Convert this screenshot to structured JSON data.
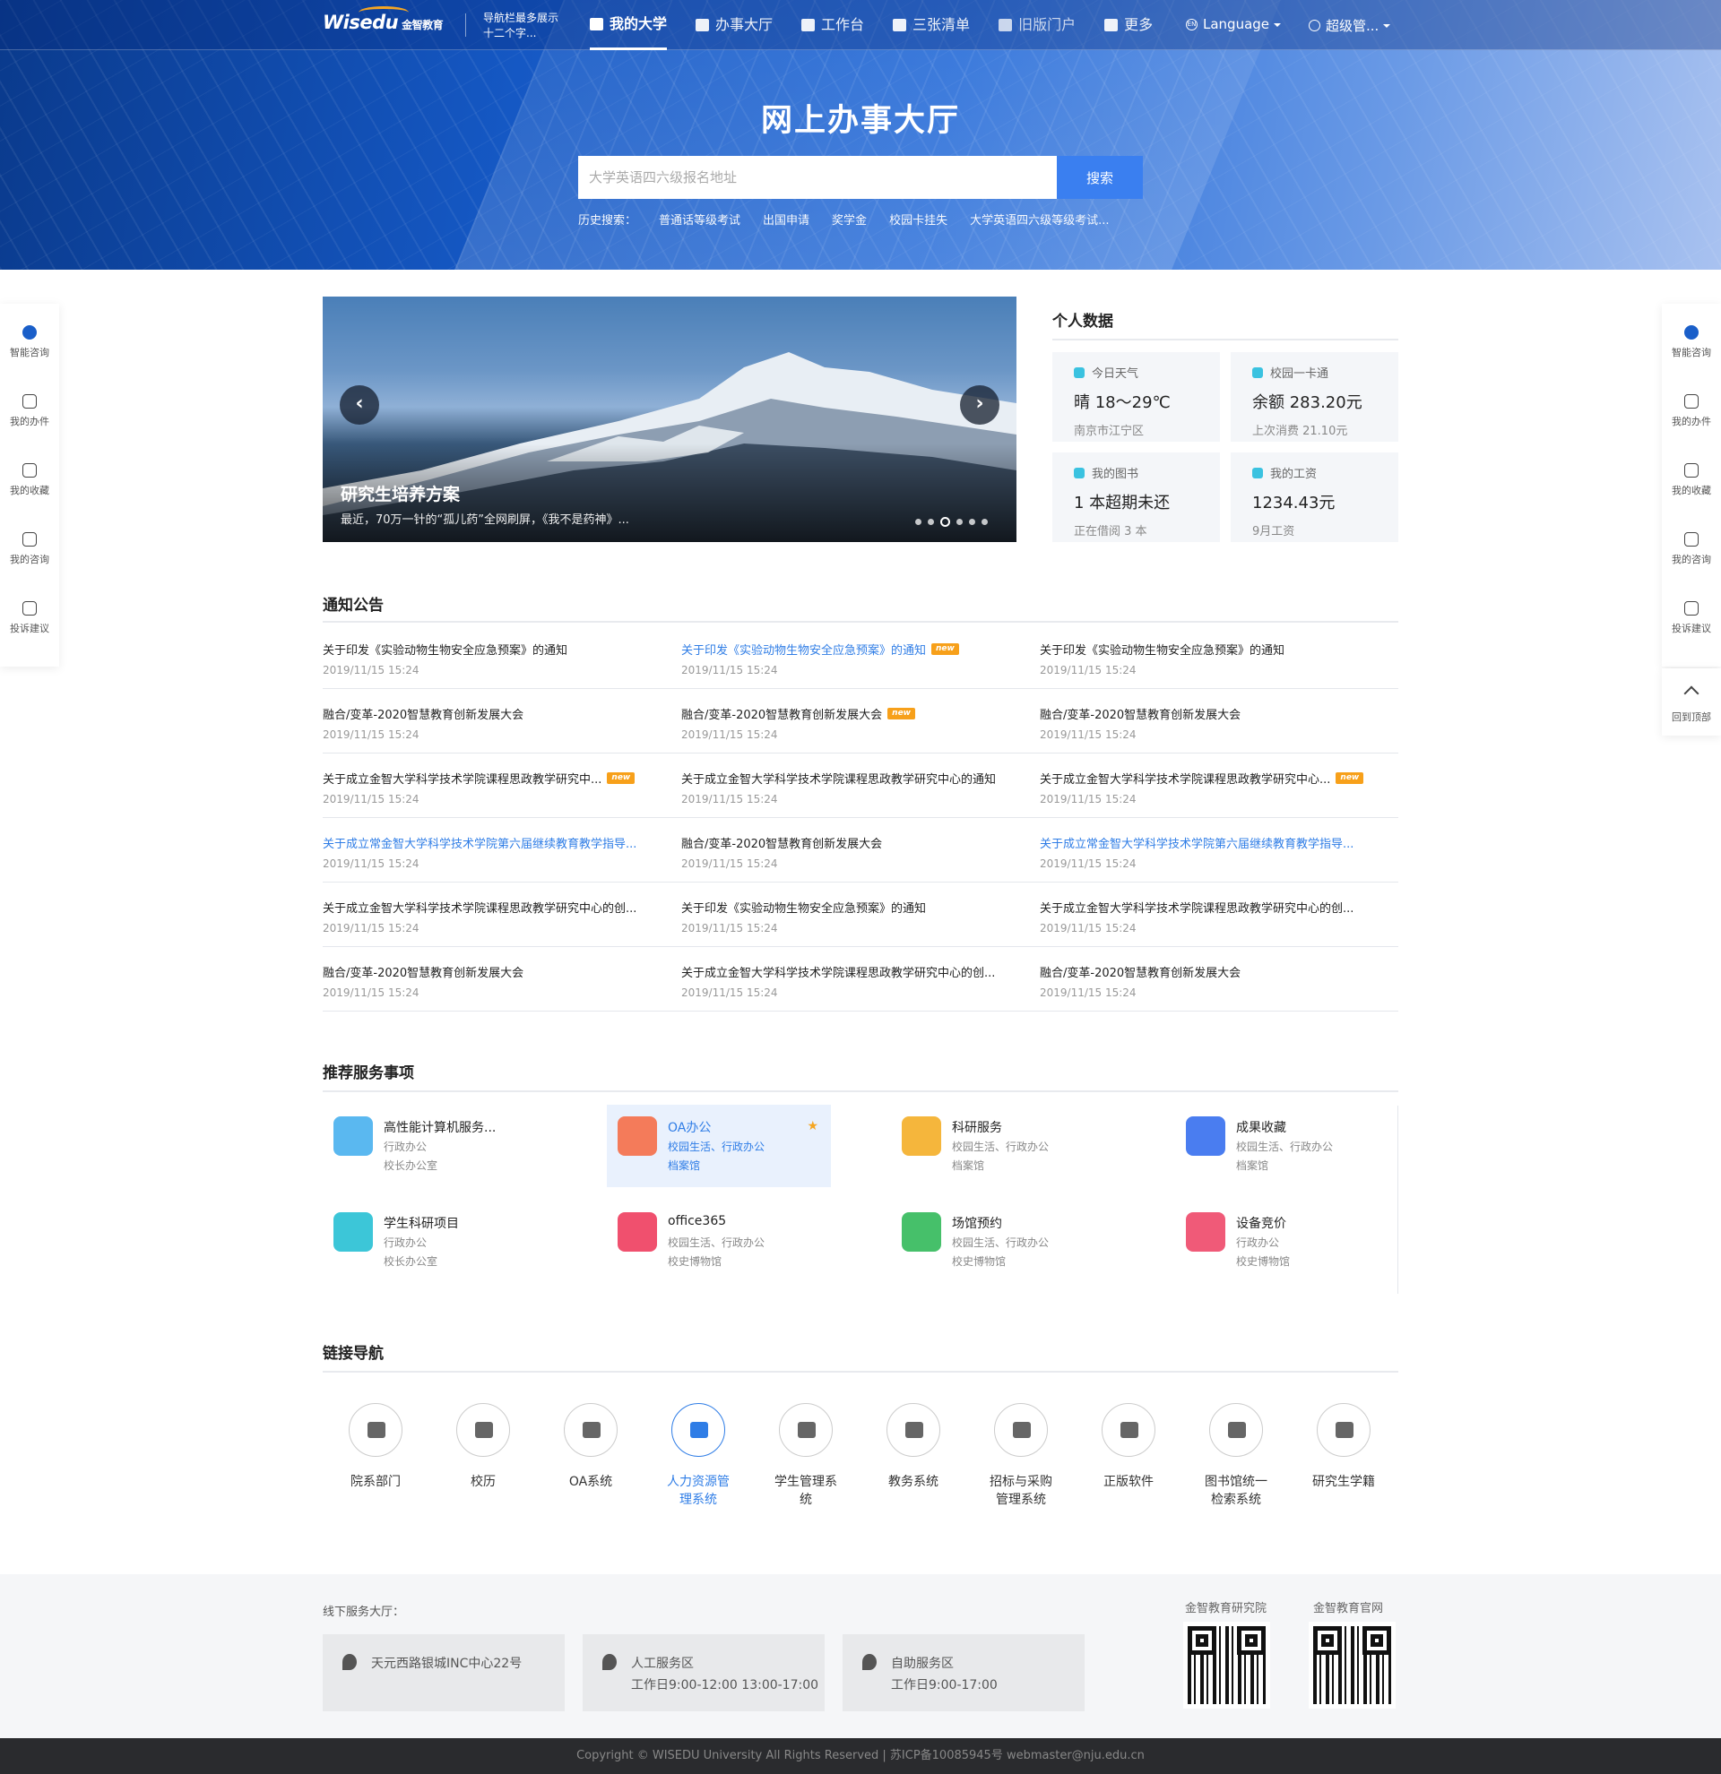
{
  "nav": {
    "logo": "Wisedu",
    "logo_cn": "金智教育",
    "note": "导航栏最多展示十二个字...",
    "menu": [
      {
        "label": "我的大学",
        "icon": "university-icon",
        "active": true
      },
      {
        "label": "办事大厅",
        "icon": "service-hall-icon",
        "active": false
      },
      {
        "label": "工作台",
        "icon": "workbench-icon",
        "active": false
      },
      {
        "label": "三张清单",
        "icon": "list-icon",
        "active": false
      },
      {
        "label": "旧版门户",
        "icon": "home-icon",
        "active": false
      },
      {
        "label": "更多",
        "icon": "grid-icon",
        "active": false
      }
    ],
    "language": "Language",
    "user": "超级管..."
  },
  "hero": {
    "title": "网上办事大厅",
    "search_placeholder": "大学英语四六级报名地址",
    "search_button": "搜索",
    "history_label": "历史搜索：",
    "history": [
      "普通话等级考试",
      "出国申请",
      "奖学金",
      "校园卡挂失",
      "大学英语四六级等级考试..."
    ]
  },
  "side_menu": [
    {
      "label": "智能咨询",
      "icon": "eye-icon"
    },
    {
      "label": "我的办件",
      "icon": "document-icon"
    },
    {
      "label": "我的收藏",
      "icon": "star-icon"
    },
    {
      "label": "我的咨询",
      "icon": "headset-icon"
    },
    {
      "label": "投诉建议",
      "icon": "feedback-icon"
    }
  ],
  "back_to_top": "回到顶部",
  "carousel": {
    "title": "研究生培养方案",
    "subtitle": "最近，70万一针的“孤儿药”全网刷屏，《我不是药神》...",
    "slide_count": 6,
    "active_index": 2
  },
  "personal": {
    "heading": "个人数据",
    "cards": [
      {
        "label": "今日天气",
        "value": "晴 18～29℃",
        "sub": "南京市江宁区"
      },
      {
        "label": "校园一卡通",
        "value": "余额 283.20元",
        "sub": "上次消费 21.10元"
      },
      {
        "label": "我的图书",
        "value": "1 本超期未还",
        "sub": "正在借阅 3 本"
      },
      {
        "label": "我的工资",
        "value": "1234.43元",
        "sub": "9月工资"
      }
    ]
  },
  "notices": {
    "heading": "通知公告",
    "new_badge": "new",
    "rows": [
      [
        {
          "title": "关于印发《实验动物生物安全应急预案》的通知",
          "date": "2019/11/15 15:24",
          "blue": false,
          "new": false
        },
        {
          "title": "关于印发《实验动物生物安全应急预案》的通知",
          "date": "2019/11/15 15:24",
          "blue": true,
          "new": true
        },
        {
          "title": "关于印发《实验动物生物安全应急预案》的通知",
          "date": "2019/11/15 15:24",
          "blue": false,
          "new": false
        }
      ],
      [
        {
          "title": "融合/变革-2020智慧教育创新发展大会",
          "date": "2019/11/15 15:24",
          "blue": false,
          "new": false
        },
        {
          "title": "融合/变革-2020智慧教育创新发展大会",
          "date": "2019/11/15 15:24",
          "blue": false,
          "new": true
        },
        {
          "title": "融合/变革-2020智慧教育创新发展大会",
          "date": "2019/11/15 15:24",
          "blue": false,
          "new": false
        }
      ],
      [
        {
          "title": "关于成立金智大学科学技术学院课程思政教学研究中...",
          "date": "2019/11/15 15:24",
          "blue": false,
          "new": true
        },
        {
          "title": "关于成立金智大学科学技术学院课程思政教学研究中心的通知",
          "date": "2019/11/15 15:24",
          "blue": false,
          "new": false
        },
        {
          "title": "关于成立金智大学科学技术学院课程思政教学研究中心...",
          "date": "2019/11/15 15:24",
          "blue": false,
          "new": true
        }
      ],
      [
        {
          "title": "关于成立常金智大学科学技术学院第六届继续教育教学指导...",
          "date": "2019/11/15 15:24",
          "blue": true,
          "new": false
        },
        {
          "title": "融合/变革-2020智慧教育创新发展大会",
          "date": "2019/11/15 15:24",
          "blue": false,
          "new": false
        },
        {
          "title": "关于成立常金智大学科学技术学院第六届继续教育教学指导...",
          "date": "2019/11/15 15:24",
          "blue": true,
          "new": false
        }
      ],
      [
        {
          "title": "关于成立金智大学科学技术学院课程思政教学研究中心的创...",
          "date": "2019/11/15 15:24",
          "blue": false,
          "new": false
        },
        {
          "title": "关于印发《实验动物生物安全应急预案》的通知",
          "date": "2019/11/15 15:24",
          "blue": false,
          "new": false
        },
        {
          "title": "关于成立金智大学科学技术学院课程思政教学研究中心的创...",
          "date": "2019/11/15 15:24",
          "blue": false,
          "new": false
        }
      ],
      [
        {
          "title": "融合/变革-2020智慧教育创新发展大会",
          "date": "2019/11/15 15:24",
          "blue": false,
          "new": false
        },
        {
          "title": "关于成立金智大学科学技术学院课程思政教学研究中心的创...",
          "date": "2019/11/15 15:24",
          "blue": false,
          "new": false
        },
        {
          "title": "融合/变革-2020智慧教育创新发展大会",
          "date": "2019/11/15 15:24",
          "blue": false,
          "new": false
        }
      ]
    ]
  },
  "services": {
    "heading": "推荐服务事项",
    "items": [
      {
        "name": "高性能计算机服务...",
        "cat": "行政办公",
        "dept": "校长办公室",
        "color": "#5ab8f0",
        "highlight": false
      },
      {
        "name": "OA办公",
        "cat": "校园生活、行政办公",
        "dept": "档案馆",
        "color": "#f47b5a",
        "highlight": true
      },
      {
        "name": "科研服务",
        "cat": "校园生活、行政办公",
        "dept": "档案馆",
        "color": "#f5b63c",
        "highlight": false
      },
      {
        "name": "成果收藏",
        "cat": "校园生活、行政办公",
        "dept": "档案馆",
        "color": "#4a7df0",
        "highlight": false
      },
      {
        "name": "学生科研项目",
        "cat": "行政办公",
        "dept": "校长办公室",
        "color": "#3cc6d8",
        "highlight": false
      },
      {
        "name": "office365",
        "cat": "校园生活、行政办公",
        "dept": "校史博物馆",
        "color": "#f0506e",
        "highlight": false
      },
      {
        "name": "场馆预约",
        "cat": "校园生活、行政办公",
        "dept": "校史博物馆",
        "color": "#46c06a",
        "highlight": false
      },
      {
        "name": "设备竞价",
        "cat": "行政办公",
        "dept": "校史博物馆",
        "color": "#f05a78",
        "highlight": false
      }
    ]
  },
  "links": {
    "heading": "链接导航",
    "items": [
      {
        "label": "院系部门",
        "icon": "layers-icon",
        "active": false
      },
      {
        "label": "校历",
        "icon": "calendar-icon",
        "active": false
      },
      {
        "label": "OA系统",
        "icon": "oa-icon",
        "active": false
      },
      {
        "label": "人力资源管理系统",
        "icon": "id-card-icon",
        "active": true
      },
      {
        "label": "学生管理系统",
        "icon": "graduation-cap-icon",
        "active": false
      },
      {
        "label": "教务系统",
        "icon": "monitor-icon",
        "active": false
      },
      {
        "label": "招标与采购管理系统",
        "icon": "coin-icon",
        "active": false
      },
      {
        "label": "正版软件",
        "icon": "windows-icon",
        "active": false
      },
      {
        "label": "图书馆统一检索系统",
        "icon": "book-search-icon",
        "active": false
      },
      {
        "label": "研究生学籍",
        "icon": "bar-chart-icon",
        "active": false
      }
    ]
  },
  "footer": {
    "offline_label": "线下服务大厅：",
    "boxes": [
      {
        "title": "天元西路银城INC中心22号",
        "sub": ""
      },
      {
        "title": "人工服务区",
        "sub": "工作日9:00-12:00 13:00-17:00"
      },
      {
        "title": "自助服务区",
        "sub": "工作日9:00-17:00"
      }
    ],
    "qr": [
      "金智教育研究院",
      "金智教育官网"
    ],
    "copyright": "Copyright © WISEDU University All Rights Reserved | 苏ICP备10085945号  webmaster@nju.edu.cn"
  }
}
